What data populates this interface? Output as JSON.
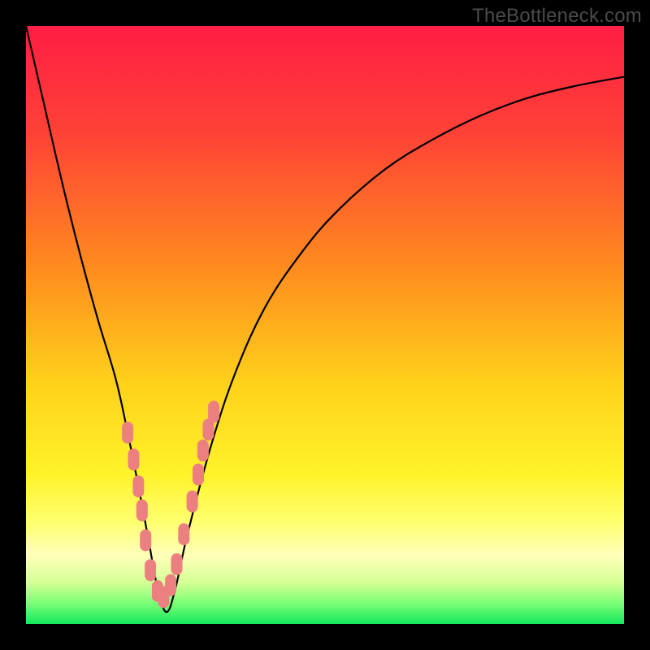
{
  "watermark": "TheBottleneck.com",
  "colors": {
    "frame": "#000000",
    "curve": "#000000",
    "marker_fill": "#ec8080",
    "marker_stroke": "#ec8080",
    "gradient_stops": [
      {
        "offset": 0.0,
        "color": "#ff1d44"
      },
      {
        "offset": 0.18,
        "color": "#ff4236"
      },
      {
        "offset": 0.4,
        "color": "#ff8a1f"
      },
      {
        "offset": 0.6,
        "color": "#ffd21a"
      },
      {
        "offset": 0.75,
        "color": "#fff32a"
      },
      {
        "offset": 0.83,
        "color": "#ffff70"
      },
      {
        "offset": 0.885,
        "color": "#ffffba"
      },
      {
        "offset": 0.93,
        "color": "#d7ff95"
      },
      {
        "offset": 0.965,
        "color": "#7bff76"
      },
      {
        "offset": 1.0,
        "color": "#15e85e"
      }
    ]
  },
  "chart_data": {
    "type": "line",
    "title": "",
    "xlabel": "",
    "ylabel": "",
    "xlim": [
      0,
      100
    ],
    "ylim": [
      0,
      100
    ],
    "series": [
      {
        "name": "bottleneck-curve",
        "x": [
          0,
          3,
          6,
          9,
          12,
          15,
          17,
          19,
          20.5,
          22,
          23.5,
          25,
          27,
          31,
          35,
          40,
          46,
          52,
          60,
          68,
          76,
          84,
          92,
          100
        ],
        "y": [
          100,
          87,
          74,
          62,
          51,
          41,
          32,
          22,
          14,
          6,
          2,
          6,
          15,
          30,
          42,
          53,
          62,
          69,
          76,
          81,
          85,
          88,
          90,
          91.5
        ]
      }
    ],
    "markers": {
      "name": "highlighted-points",
      "x": [
        17.0,
        18.0,
        18.8,
        19.4,
        20.0,
        20.8,
        22.0,
        23.0,
        24.2,
        25.2,
        26.4,
        27.8,
        28.8,
        29.6,
        30.5,
        31.4
      ],
      "y": [
        32.0,
        27.5,
        23.0,
        19.0,
        14.0,
        9.0,
        5.5,
        4.5,
        6.5,
        10.0,
        15.0,
        20.5,
        25.0,
        29.0,
        32.5,
        35.5
      ]
    }
  }
}
